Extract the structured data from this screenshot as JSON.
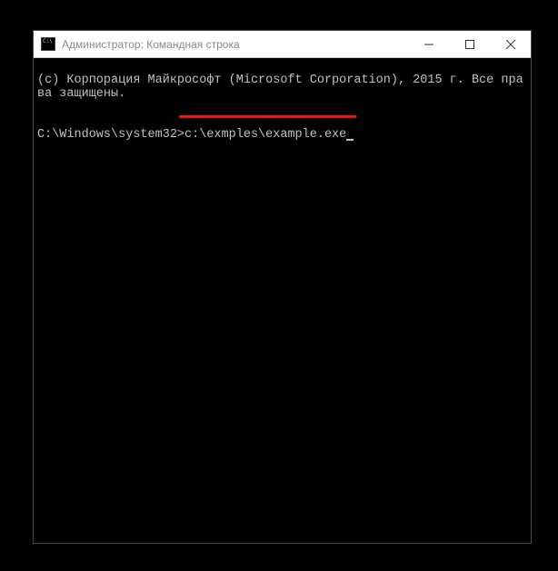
{
  "window": {
    "title": "Администратор: Командная строка"
  },
  "titlebar_buttons": {
    "minimize": "minimize",
    "maximize": "maximize",
    "close": "close"
  },
  "console": {
    "copyright": "(c) Корпорация Майкрософт (Microsoft Corporation), 2015 г. Все права защищены.",
    "prompt": "C:\\Windows\\system32>",
    "command": "c:\\exmples\\example.exe"
  },
  "annotation": {
    "underline_color": "#e8180f"
  }
}
